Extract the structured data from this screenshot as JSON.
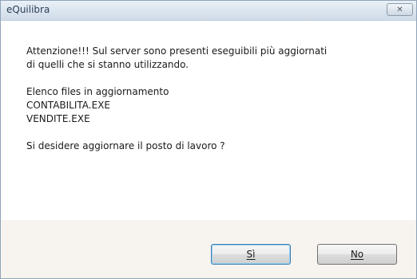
{
  "window": {
    "title": "eQuilibra",
    "close_glyph": "✕"
  },
  "message": {
    "line1": "Attenzione!!! Sul server sono presenti eseguibili più aggiornati",
    "line2": "di quelli che si stanno utilizzando.",
    "list_header": "Elenco files in aggiornamento",
    "files": [
      "CONTABILITA.EXE",
      "VENDITE.EXE"
    ],
    "question": "Si desidere aggiornare il posto di lavoro ?"
  },
  "buttons": {
    "yes_label": "Sì",
    "no_label": "No"
  },
  "icons": {
    "close": "close-icon"
  }
}
